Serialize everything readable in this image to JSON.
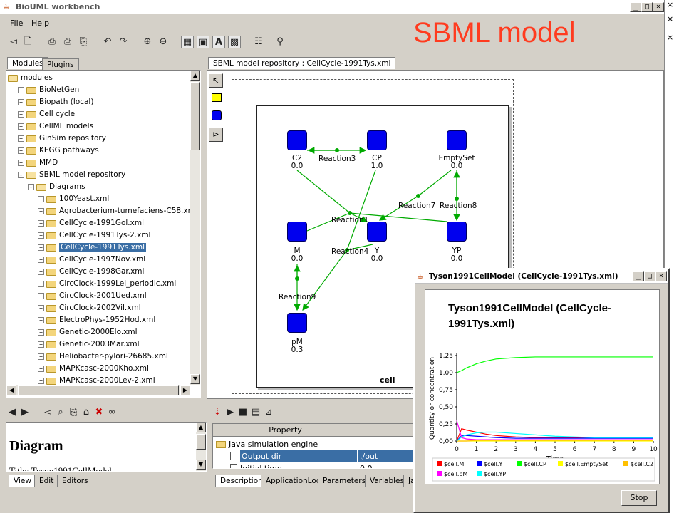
{
  "window": {
    "title": "BioUML workbench"
  },
  "menu": [
    "File",
    "Help"
  ],
  "overlay_title": "SBML model",
  "left_tabs": [
    "Modules",
    "Plugins"
  ],
  "tree": [
    {
      "label": "modules",
      "level": 0,
      "type": "open",
      "pm": ""
    },
    {
      "label": "BioNetGen",
      "level": 1,
      "type": "closed",
      "pm": "+"
    },
    {
      "label": "Biopath (local)",
      "level": 1,
      "type": "closed",
      "pm": "+"
    },
    {
      "label": "Cell cycle",
      "level": 1,
      "type": "closed",
      "pm": "+"
    },
    {
      "label": "CellML models",
      "level": 1,
      "type": "closed",
      "pm": "+"
    },
    {
      "label": "GinSim repository",
      "level": 1,
      "type": "closed",
      "pm": "+"
    },
    {
      "label": "KEGG pathways",
      "level": 1,
      "type": "closed",
      "pm": "+"
    },
    {
      "label": "MMD",
      "level": 1,
      "type": "closed",
      "pm": "+"
    },
    {
      "label": "SBML model repository",
      "level": 1,
      "type": "open",
      "pm": "-"
    },
    {
      "label": "Diagrams",
      "level": 2,
      "type": "open",
      "pm": "-"
    },
    {
      "label": "100Yeast.xml",
      "level": 3,
      "type": "closed",
      "pm": "+"
    },
    {
      "label": "Agrobacterium-tumefaciens-C58.xml",
      "level": 3,
      "type": "closed",
      "pm": "+"
    },
    {
      "label": "CellCycle-1991Gol.xml",
      "level": 3,
      "type": "closed",
      "pm": "+"
    },
    {
      "label": "CellCycle-1991Tys-2.xml",
      "level": 3,
      "type": "closed",
      "pm": "+"
    },
    {
      "label": "CellCycle-1991Tys.xml",
      "level": 3,
      "type": "closed",
      "pm": "+",
      "selected": true
    },
    {
      "label": "CellCycle-1997Nov.xml",
      "level": 3,
      "type": "closed",
      "pm": "+"
    },
    {
      "label": "CellCycle-1998Gar.xml",
      "level": 3,
      "type": "closed",
      "pm": "+"
    },
    {
      "label": "CircClock-1999Lel_periodic.xml",
      "level": 3,
      "type": "closed",
      "pm": "+"
    },
    {
      "label": "CircClock-2001Ued.xml",
      "level": 3,
      "type": "closed",
      "pm": "+"
    },
    {
      "label": "CircClock-2002Vil.xml",
      "level": 3,
      "type": "closed",
      "pm": "+"
    },
    {
      "label": "ElectroPhys-1952Hod.xml",
      "level": 3,
      "type": "closed",
      "pm": "+"
    },
    {
      "label": "Genetic-2000Elo.xml",
      "level": 3,
      "type": "closed",
      "pm": "+"
    },
    {
      "label": "Genetic-2003Mar.xml",
      "level": 3,
      "type": "closed",
      "pm": "+"
    },
    {
      "label": "Heliobacter-pylori-26685.xml",
      "level": 3,
      "type": "closed",
      "pm": "+"
    },
    {
      "label": "MAPKcasc-2000Kho.xml",
      "level": 3,
      "type": "closed",
      "pm": "+"
    },
    {
      "label": "MAPKcasc-2000Lev-2.xml",
      "level": 3,
      "type": "closed",
      "pm": "+"
    }
  ],
  "editor_tab": "SBML model repository : CellCycle-1991Tys.xml",
  "diagram": {
    "compartment": "cell",
    "nodes": [
      {
        "id": "C2",
        "name": "C2",
        "value": "0.0"
      },
      {
        "id": "CP",
        "name": "CP",
        "value": "1.0"
      },
      {
        "id": "EmptySet",
        "name": "EmptySet",
        "value": "0.0"
      },
      {
        "id": "M",
        "name": "M",
        "value": "0.0"
      },
      {
        "id": "Y",
        "name": "Y",
        "value": "0.0"
      },
      {
        "id": "YP",
        "name": "YP",
        "value": "0.0"
      },
      {
        "id": "pM",
        "name": "pM",
        "value": "0.3"
      }
    ],
    "reactions": [
      "Reaction3",
      "Reaction1",
      "Reaction4",
      "Reaction7",
      "Reaction8",
      "Reaction9"
    ]
  },
  "info_panel": {
    "heading": "Diagram",
    "title_line": "Title: Tyson1991CellModel"
  },
  "bottom_left_tabs": [
    "View",
    "Edit",
    "Editors"
  ],
  "properties": {
    "header": "Property",
    "rows": [
      {
        "name": "Java simulation engine",
        "value": ""
      },
      {
        "name": "Output dir",
        "value": "./out"
      },
      {
        "name": "Initial time",
        "value": "0.0"
      }
    ]
  },
  "bottom_tabs": [
    "Description",
    "ApplicationLog",
    "Parameters",
    "Variables",
    "Ja"
  ],
  "sim_window": {
    "title": "Tyson1991CellModel (CellCycle-1991Tys.xml)",
    "stop_label": "Stop"
  },
  "colors": {
    "overlay": "#ff3b1f",
    "selection": "#3a6ea5",
    "node": "#0000ee",
    "edge": "#00aa00",
    "titlebar_active": "#0a246a"
  },
  "chart_data": {
    "type": "line",
    "title": "Tyson1991CellModel (CellCycle-1991Tys.xml)",
    "xlabel": "Time",
    "ylabel": "Quantity or concentration",
    "xlim": [
      0,
      10
    ],
    "ylim": [
      0,
      1.25
    ],
    "xticks": [
      "0",
      "1",
      "2",
      "3",
      "4",
      "5",
      "6",
      "7",
      "8",
      "9",
      "10"
    ],
    "yticks": [
      "0,00",
      "0,25",
      "0,50",
      "0,75",
      "1,00",
      "1,25"
    ],
    "legend": "bottom",
    "grid": false,
    "x": [
      0,
      0.25,
      0.5,
      1,
      1.5,
      2,
      3,
      4,
      5,
      6,
      7,
      8,
      9,
      10
    ],
    "series": [
      {
        "name": "$cell.M",
        "color": "#ff0000",
        "values": [
          0.0,
          0.18,
          0.16,
          0.13,
          0.1,
          0.08,
          0.06,
          0.05,
          0.05,
          0.05,
          0.05,
          0.05,
          0.05,
          0.05
        ]
      },
      {
        "name": "$cell.Y",
        "color": "#0000ff",
        "values": [
          0.0,
          0.08,
          0.08,
          0.07,
          0.06,
          0.05,
          0.04,
          0.04,
          0.04,
          0.04,
          0.04,
          0.04,
          0.04,
          0.04
        ]
      },
      {
        "name": "$cell.CP",
        "color": "#00ff00",
        "values": [
          1.0,
          1.03,
          1.07,
          1.13,
          1.17,
          1.2,
          1.22,
          1.23,
          1.23,
          1.23,
          1.23,
          1.23,
          1.23,
          1.23
        ]
      },
      {
        "name": "$cell.EmptySet",
        "color": "#ffff00",
        "values": [
          0,
          0,
          0,
          0,
          0,
          0,
          0,
          0,
          0,
          0,
          0,
          0,
          0,
          0
        ]
      },
      {
        "name": "$cell.C2",
        "color": "#ffc000",
        "values": [
          0.0,
          0.0,
          0.0,
          0.01,
          0.01,
          0.01,
          0.01,
          0.01,
          0.01,
          0.01,
          0.01,
          0.01,
          0.01,
          0.01
        ]
      },
      {
        "name": "$cell.pM",
        "color": "#ff00ff",
        "values": [
          0.3,
          0.05,
          0.03,
          0.02,
          0.02,
          0.02,
          0.02,
          0.02,
          0.02,
          0.02,
          0.02,
          0.02,
          0.02,
          0.02
        ]
      },
      {
        "name": "$cell.YP",
        "color": "#00ffff",
        "values": [
          0.0,
          0.06,
          0.09,
          0.12,
          0.13,
          0.13,
          0.11,
          0.09,
          0.07,
          0.06,
          0.05,
          0.05,
          0.05,
          0.05
        ]
      }
    ]
  }
}
